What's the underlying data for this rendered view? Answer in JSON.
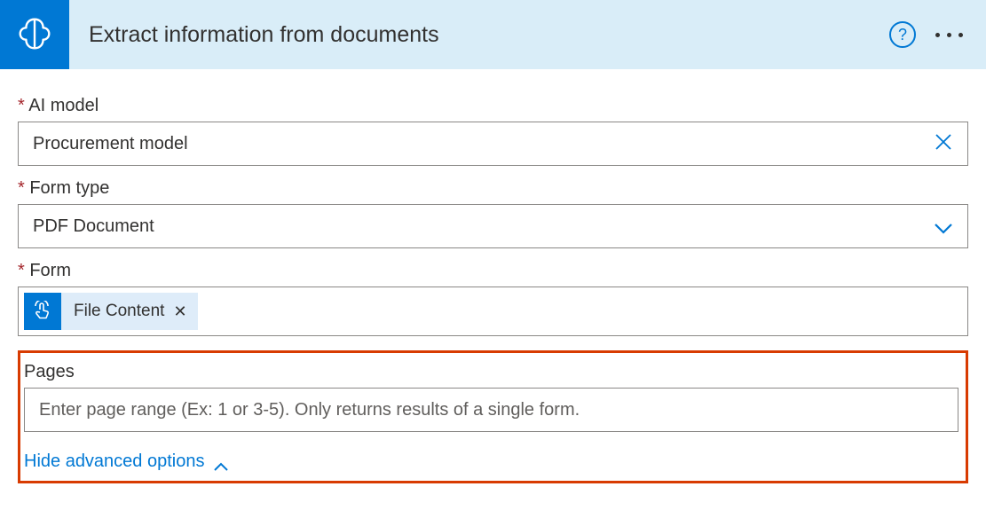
{
  "header": {
    "title": "Extract information from documents"
  },
  "fields": {
    "ai_model": {
      "label": "AI model",
      "value": "Procurement model"
    },
    "form_type": {
      "label": "Form type",
      "value": "PDF Document"
    },
    "form": {
      "label": "Form",
      "token_label": "File Content"
    },
    "pages": {
      "label": "Pages",
      "placeholder": "Enter page range (Ex: 1 or 3-5). Only returns results of a single form."
    }
  },
  "advanced": {
    "hide_label": "Hide advanced options"
  }
}
